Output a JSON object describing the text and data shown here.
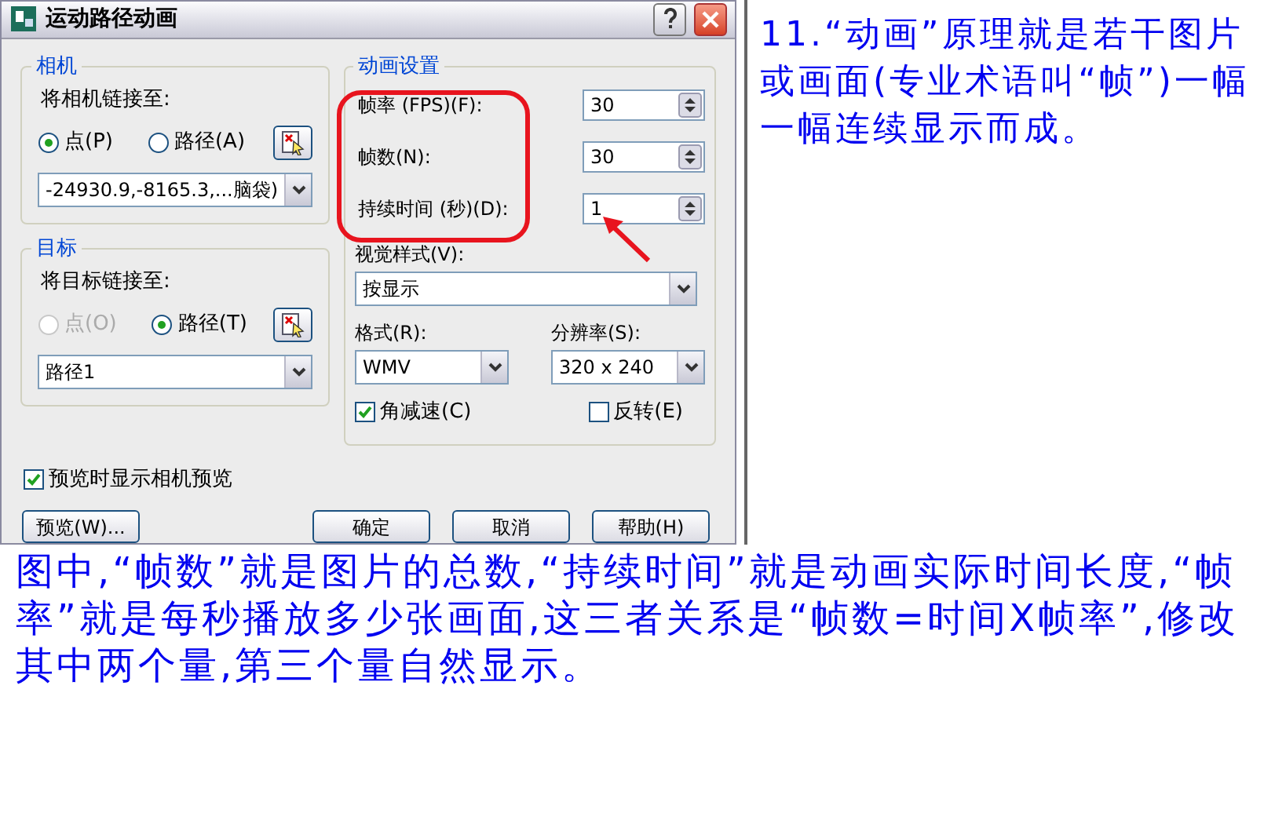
{
  "dialog": {
    "title": "运动路径动画",
    "camera": {
      "title": "相机",
      "link_label": "将相机链接至:",
      "radios": [
        {
          "label": "点(P)",
          "selected": true,
          "disabled": false
        },
        {
          "label": "路径(A)",
          "selected": false,
          "disabled": false
        }
      ],
      "select_value": "-24930.9,-8165.3,...脑袋)"
    },
    "target": {
      "title": "目标",
      "link_label": "将目标链接至:",
      "radios": [
        {
          "label": "点(O)",
          "selected": false,
          "disabled": true
        },
        {
          "label": "路径(T)",
          "selected": true,
          "disabled": false
        }
      ],
      "select_value": "路径1"
    },
    "animation": {
      "title": "动画设置",
      "spinners": [
        {
          "label": "帧率 (FPS)(F):",
          "value": "30"
        },
        {
          "label": "帧数(N):",
          "value": "30"
        },
        {
          "label": "持续时间 (秒)(D):",
          "value": "1"
        }
      ],
      "visual_style": {
        "label": "视觉样式(V):",
        "value": "按显示"
      },
      "format": {
        "label": "格式(R):",
        "value": "WMV"
      },
      "resolution": {
        "label": "分辨率(S):",
        "value": "320 x 240"
      },
      "checkboxes": [
        {
          "label": "角减速(C)",
          "checked": true
        },
        {
          "label": "反转(E)",
          "checked": false
        }
      ]
    },
    "preview_checkbox": {
      "label": "预览时显示相机预览",
      "checked": true
    },
    "buttons": [
      {
        "label": "预览(W)..."
      },
      {
        "label": "确定"
      },
      {
        "label": "取消"
      },
      {
        "label": "帮助(H)"
      }
    ]
  },
  "annotation": "11.“动画”原理就是若干图片或画面(专业术语叫“帧”)一幅一幅连续显示而成。",
  "caption": "图中,“帧数”就是图片的总数,“持续时间”就是动画实际时间长度,“帧率”就是每秒播放多少张画面,这三者关系是“帧数=时间X帧率”,修改其中两个量,第三个量自然显示。"
}
